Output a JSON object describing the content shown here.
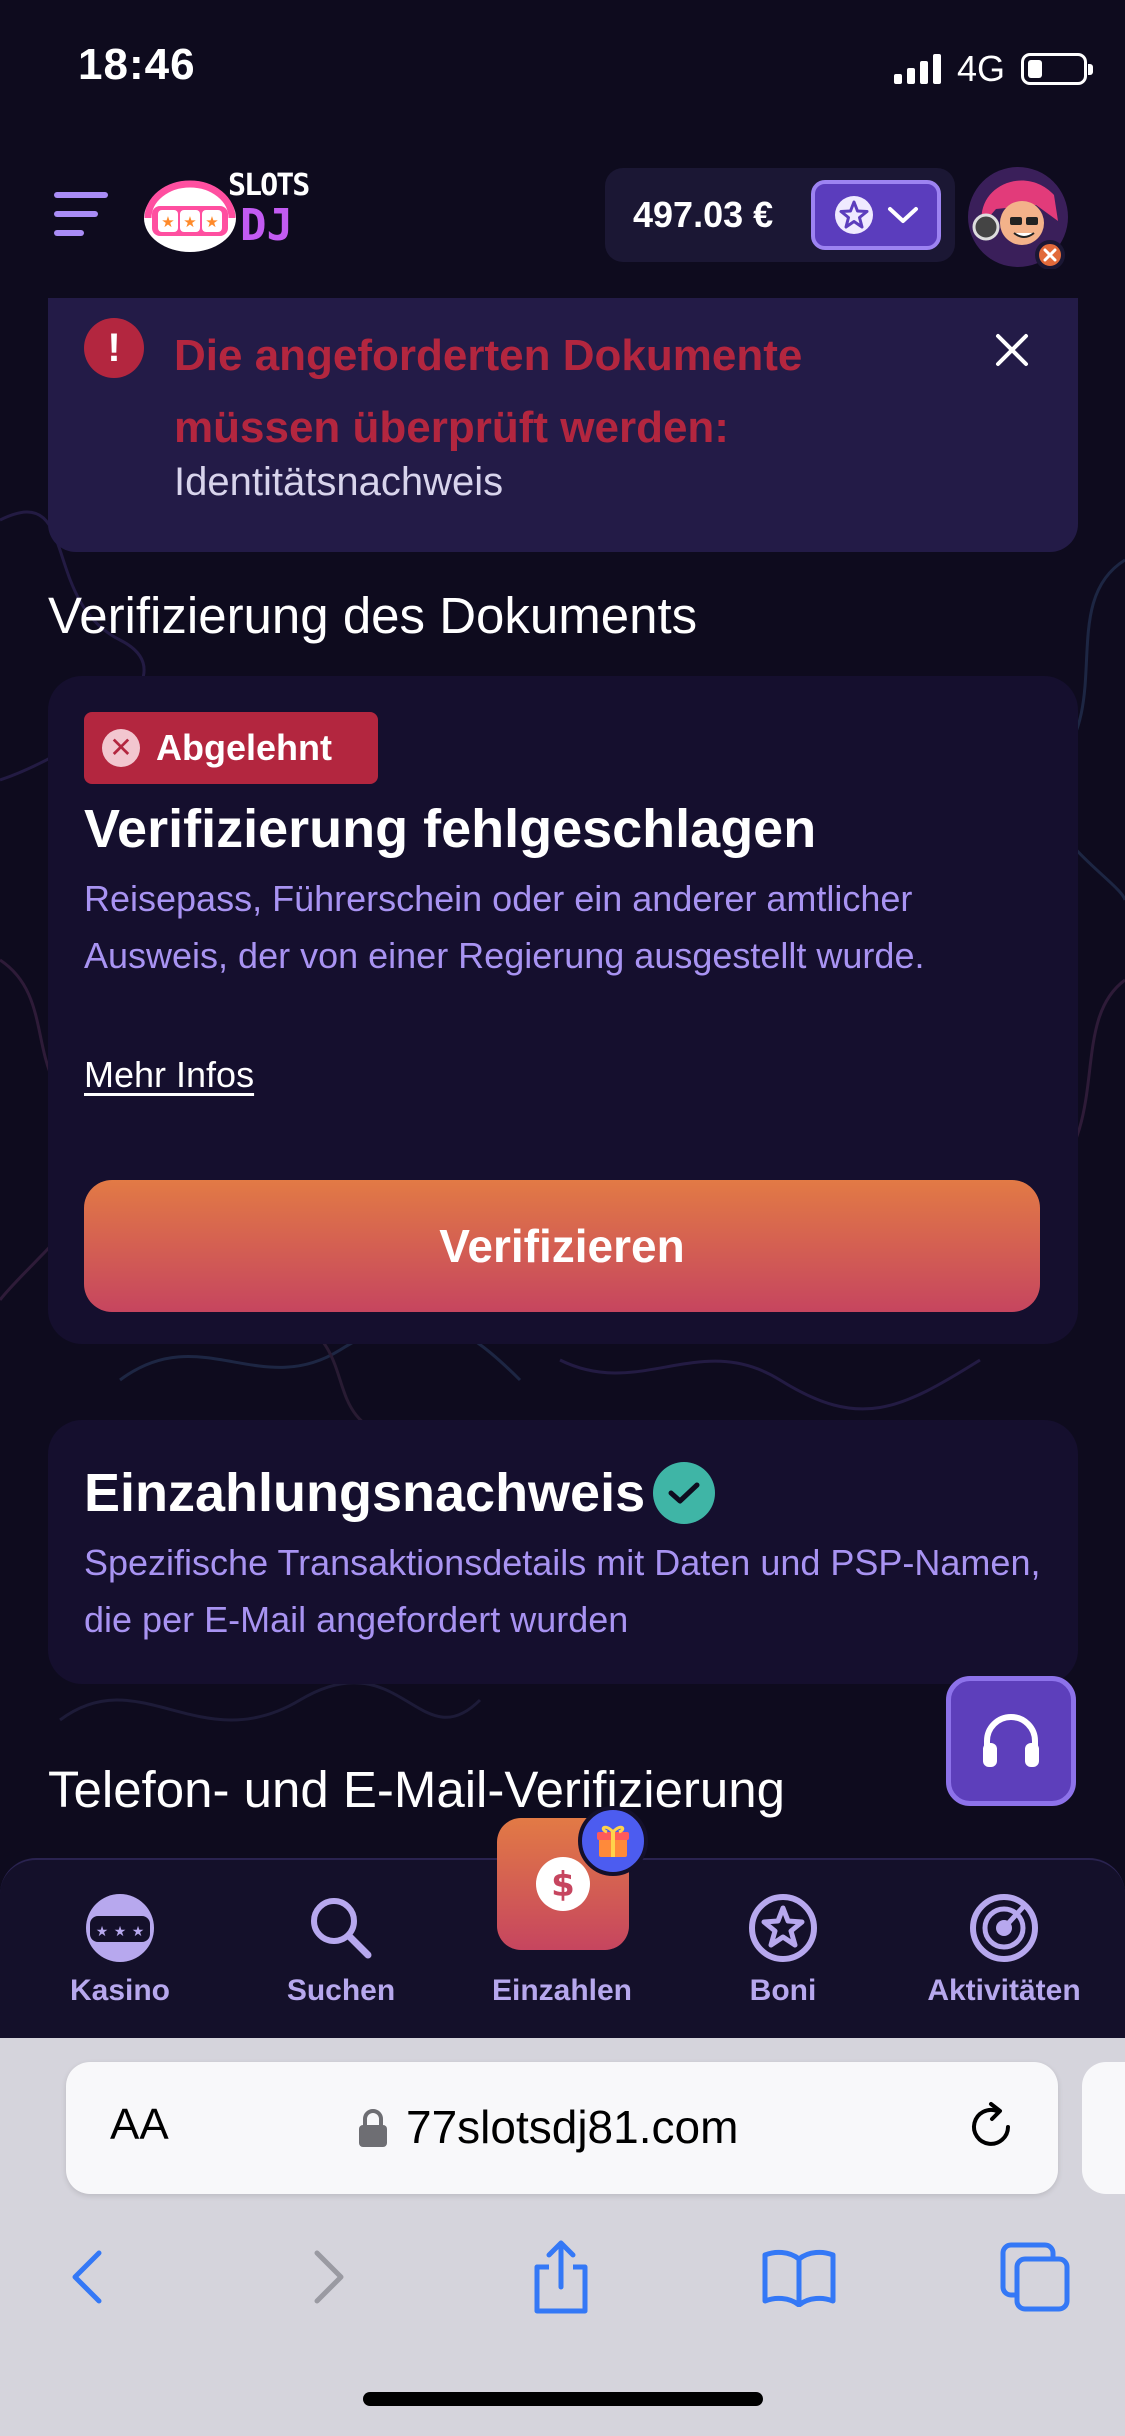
{
  "status_bar": {
    "time": "18:46",
    "network": "4G"
  },
  "header": {
    "logo_text_top": "SLOTS",
    "logo_text_bottom": "DJ",
    "balance": "497.03 €"
  },
  "alert": {
    "title": "Die angeforderten Dokumente müssen überprüft werden:",
    "text": "Identitätsnachweis"
  },
  "document_section": {
    "title": "Verifizierung des Dokuments",
    "badge": "Abgelehnt",
    "card_title": "Verifizierung fehlgeschlagen",
    "description": "Reisepass, Führerschein oder ein anderer amtlicher Ausweis, der von einer Regierung ausgestellt wurde.",
    "more_link": "Mehr Infos",
    "button": "Verifizieren"
  },
  "deposit_proof": {
    "title": "Einzahlungsnachweis",
    "description": "Spezifische Transaktionsdetails mit Daten und PSP-Namen, die per E-Mail angefordert wurden"
  },
  "phone_section": {
    "title": "Telefon- und E-Mail-Verifizierung"
  },
  "bottom_nav": {
    "items": [
      {
        "label": "Kasino",
        "icon": "casino-icon"
      },
      {
        "label": "Suchen",
        "icon": "search-icon"
      },
      {
        "label": "Einzahlen",
        "icon": "dollar-icon"
      },
      {
        "label": "Boni",
        "icon": "star-icon"
      },
      {
        "label": "Aktivitäten",
        "icon": "activity-icon"
      }
    ]
  },
  "browser": {
    "text_size": "AA",
    "url": "77slotsdj81.com"
  },
  "colors": {
    "background": "#0e0b1e",
    "accent_purple": "#5b3dbd",
    "error_red": "#b3263f",
    "success_teal": "#3fb5a6",
    "button_gradient_top": "#e27a45",
    "button_gradient_bottom": "#c6455f"
  }
}
